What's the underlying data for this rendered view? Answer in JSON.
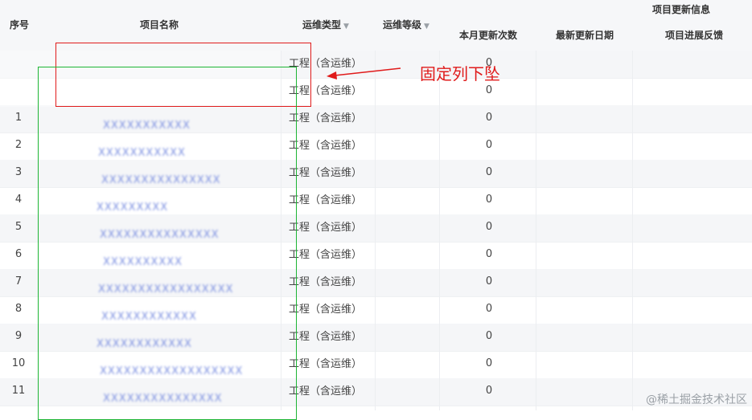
{
  "columns": {
    "index": "序号",
    "project_name": "项目名称",
    "ops_type": "运维类型",
    "ops_level": "运维等级",
    "group_title": "项目更新信息",
    "monthly_updates": "本月更新次数",
    "latest_update_date": "最新更新日期",
    "progress_feedback": "项目进展反馈"
  },
  "sort_icon": "sort-down-caret-icon",
  "rows": [
    {
      "index": "",
      "name": "",
      "type": "工程（含运维）",
      "count": "0"
    },
    {
      "index": "",
      "name": "",
      "type": "工程（含运维）",
      "count": "0"
    },
    {
      "index": "1",
      "name": "XXXXXXXXXXX",
      "type": "工程（含运维）",
      "count": "0"
    },
    {
      "index": "2",
      "name": "XXXXXXXXXXX",
      "type": "工程（含运维）",
      "count": "0"
    },
    {
      "index": "3",
      "name": "XXXXXXXXXXXXXXX",
      "type": "工程（含运维）",
      "count": "0"
    },
    {
      "index": "4",
      "name": "XXXXXXXXX",
      "type": "工程（含运维）",
      "count": "0"
    },
    {
      "index": "5",
      "name": "XXXXXXXXXXXXXXX",
      "type": "工程（含运维）",
      "count": "0"
    },
    {
      "index": "6",
      "name": "XXXXXXXXXX",
      "type": "工程（含运维）",
      "count": "0"
    },
    {
      "index": "7",
      "name": "XXXXXXXXXXXXXXXXX",
      "type": "工程（含运维）",
      "count": "0"
    },
    {
      "index": "8",
      "name": "XXXXXXXXXXXX",
      "type": "工程（含运维）",
      "count": "0"
    },
    {
      "index": "9",
      "name": "XXXXXXXXXXXX",
      "type": "工程（含运维）",
      "count": "0"
    },
    {
      "index": "10",
      "name": "XXXXXXXXXXXXXXXXXX",
      "type": "工程（含运维）",
      "count": "0"
    },
    {
      "index": "11",
      "name": "XXXXXXXXXXXXXXX",
      "type": "工程（含运维）",
      "count": "0"
    }
  ],
  "annotation": {
    "text": "固定列下坠",
    "color": "#e01b1b",
    "box_colors": {
      "frozen_area": "#e01b1b",
      "dropped_column": "#1db534"
    }
  },
  "watermark": "@稀土掘金技术社区"
}
